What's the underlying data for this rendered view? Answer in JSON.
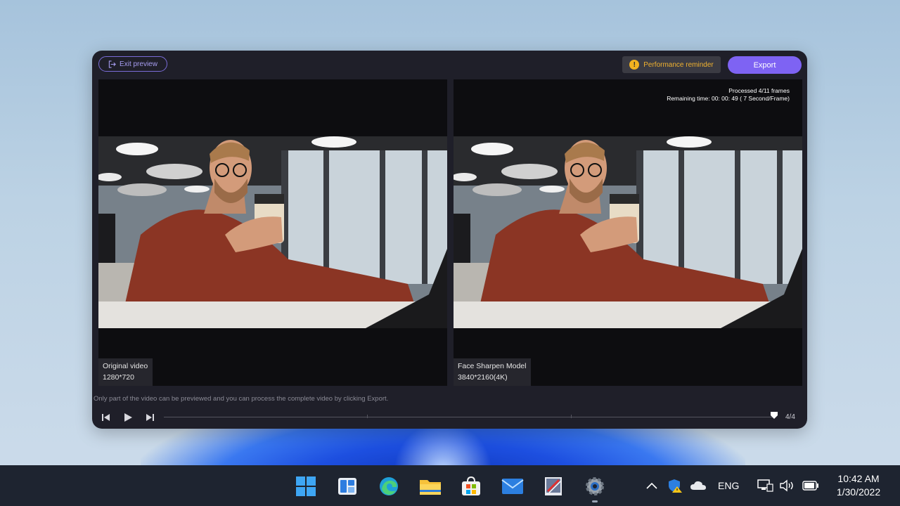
{
  "topbar": {
    "exit_label": "Exit preview",
    "performance_label": "Performance reminder",
    "export_label": "Export"
  },
  "left_panel": {
    "caption_title": "Original video",
    "caption_resolution": "1280*720"
  },
  "right_panel": {
    "processed_text": "Processed 4/11 frames",
    "remaining_text": "Remaining time: 00: 00: 49 ( 7 Second/Frame)",
    "caption_title": "Face Sharpen Model",
    "caption_resolution": "3840*2160(4K)"
  },
  "footer": {
    "hint": "Only part of the video can be previewed and you can process the complete video by clicking Export.",
    "page_count": "4/4",
    "playhead_fraction": 1.0
  },
  "taskbar": {
    "icons": [
      "windows-start-icon",
      "widgets-icon",
      "edge-icon",
      "file-explorer-icon",
      "store-icon",
      "mail-icon",
      "photo-app-icon",
      "settings-icon"
    ],
    "language": "ENG",
    "time": "10:42 AM",
    "date": "1/30/2022"
  },
  "colors": {
    "accent": "#7e63f3",
    "warning": "#f2b21f",
    "window_bg": "#1f1f29"
  }
}
